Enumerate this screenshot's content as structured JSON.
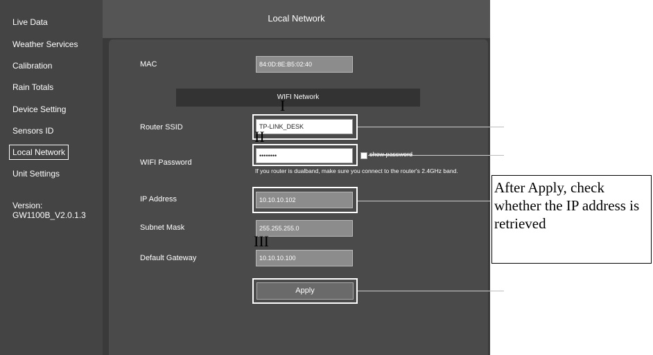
{
  "sidebar": {
    "items": [
      {
        "label": "Live Data"
      },
      {
        "label": "Weather Services"
      },
      {
        "label": "Calibration"
      },
      {
        "label": "Rain Totals"
      },
      {
        "label": "Device Setting"
      },
      {
        "label": "Sensors ID"
      },
      {
        "label": "Local Network",
        "active": true
      },
      {
        "label": "Unit Settings"
      }
    ],
    "version_label": "Version:",
    "version_value": "GW1100B_V2.0.1.3"
  },
  "header": {
    "title": "Local Network"
  },
  "form": {
    "mac_label": "MAC",
    "mac_value": "84:0D:8E:B5:02:40",
    "wifi_section": "WIFI Network",
    "ssid_label": "Router SSID",
    "ssid_value": "TP-LINK_DESK",
    "password_label": "WIFI Password",
    "password_value": "••••••••",
    "show_password_label": "show password",
    "dualband_note": "If you router is dualband, make sure you connect to the router's 2.4GHz band.",
    "ip_label": "IP Address",
    "ip_value": "10.10.10.102",
    "subnet_label": "Subnet Mask",
    "subnet_value": "255.255.255.0",
    "gateway_label": "Default Gateway",
    "gateway_value": "10.10.10.100",
    "apply_label": "Apply"
  },
  "annotations": {
    "marker_1": "I",
    "marker_2": "II",
    "marker_3": "III",
    "callout_text": "After Apply, check whether the IP address is retrieved"
  },
  "colors": {
    "app_background": "#3a3a3a",
    "sidebar_background": "#444444",
    "field_background": "#8c8c8c"
  }
}
